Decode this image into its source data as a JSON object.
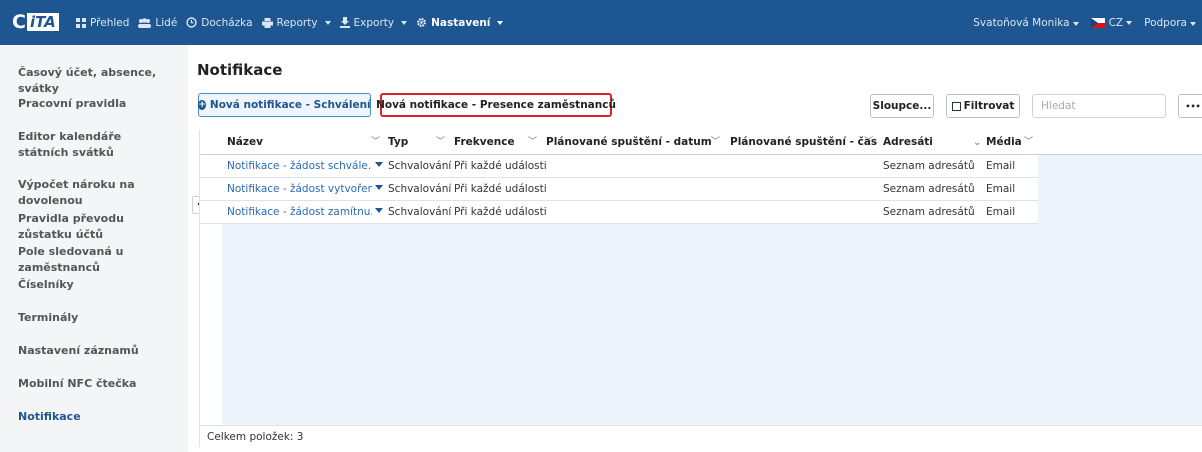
{
  "app": {
    "logo_text_1": "C",
    "logo_text_2": "iTA"
  },
  "nav": {
    "items": [
      {
        "label": "Přehled",
        "icon": "grid-icon",
        "caret": false
      },
      {
        "label": "Lidé",
        "icon": "people-icon",
        "caret": false
      },
      {
        "label": "Docházka",
        "icon": "clock-icon",
        "caret": false
      },
      {
        "label": "Reporty",
        "icon": "printer-icon",
        "caret": true
      },
      {
        "label": "Exporty",
        "icon": "export-icon",
        "caret": true
      },
      {
        "label": "Nastavení",
        "icon": "gear-icon",
        "caret": true,
        "active": true
      }
    ],
    "user": "Svatoňová Monika",
    "language": "CZ",
    "support": "Podpora"
  },
  "sidebar": {
    "items": [
      {
        "label": "Časový účet, absence, svátky"
      },
      {
        "label": "Pracovní pravidla"
      },
      {
        "label": "Editor kalendáře státních svátků"
      },
      {
        "label": "Výpočet nároku na dovolenou"
      },
      {
        "label": "Pravidla převodu zůstatku účtů"
      },
      {
        "label": "Pole sledovaná u zaměstnanců"
      },
      {
        "label": "Číselníky"
      },
      {
        "label": "Terminály"
      },
      {
        "label": "Nastavení záznamů"
      },
      {
        "label": "Mobilní NFC čtečka"
      },
      {
        "label": "Notifikace",
        "active": true
      }
    ]
  },
  "main": {
    "title": "Notifikace",
    "toolbar": {
      "new_approval": "Nová notifikace - Schválení",
      "new_presence": "Nová notifikace - Presence zaměstnanců",
      "columns": "Sloupce...",
      "filter": "Filtrovat",
      "search_placeholder": "Hledat",
      "more": "•••"
    },
    "table": {
      "columns": [
        "Název",
        "Typ",
        "Frekvence",
        "Plánované spuštění - datum",
        "Plánované spuštění - čas",
        "Adresáti",
        "Média"
      ],
      "rows": [
        [
          "Notifikace - žádost schvále...",
          "Schvalování",
          "Při každé události",
          "",
          "",
          "Seznam adresátů",
          "Email"
        ],
        [
          "Notifikace - žádost vytvořena",
          "Schvalování",
          "Při každé události",
          "",
          "",
          "Seznam adresátů",
          "Email"
        ],
        [
          "Notifikace - žádost zamítnu...",
          "Schvalování",
          "Při každé události",
          "",
          "",
          "Seznam adresátů",
          "Email"
        ]
      ],
      "footer": "Celkem položek: 3"
    }
  },
  "colors": {
    "nav_bg": "#1d5690",
    "accent": "#1d5690",
    "highlight": "#d9232e"
  }
}
